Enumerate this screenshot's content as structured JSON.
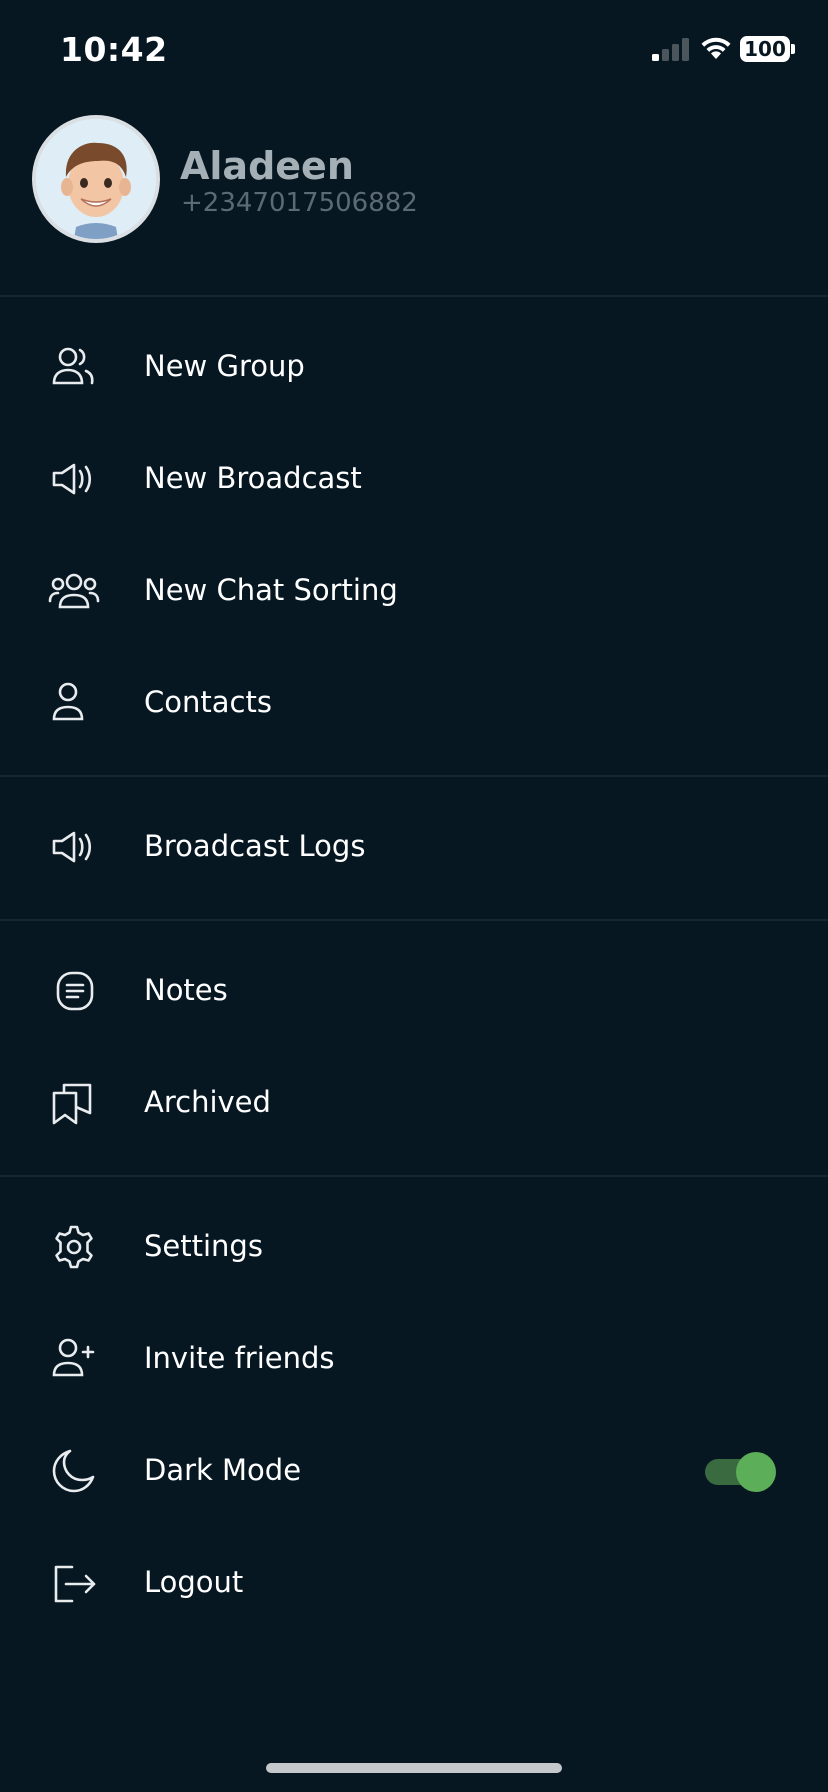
{
  "status_bar": {
    "time": "10:42",
    "battery": "100"
  },
  "profile": {
    "name": "Aladeen",
    "phone": "+2347017506882"
  },
  "menu": {
    "group1": [
      {
        "label": "New Group",
        "icon": "group-icon"
      },
      {
        "label": "New Broadcast",
        "icon": "megaphone-icon"
      },
      {
        "label": "New Chat Sorting",
        "icon": "users-sort-icon"
      },
      {
        "label": "Contacts",
        "icon": "person-icon"
      }
    ],
    "group2": [
      {
        "label": "Broadcast Logs",
        "icon": "megaphone-icon"
      }
    ],
    "group3": [
      {
        "label": "Notes",
        "icon": "notes-icon"
      },
      {
        "label": "Archived",
        "icon": "bookmarks-icon"
      }
    ],
    "group4": [
      {
        "label": "Settings",
        "icon": "gear-icon"
      },
      {
        "label": "Invite friends",
        "icon": "person-add-icon"
      },
      {
        "label": "Dark Mode",
        "icon": "moon-icon",
        "toggle_on": true
      },
      {
        "label": "Logout",
        "icon": "logout-icon"
      }
    ]
  },
  "colors": {
    "background": "#071722",
    "divider": "#16252f",
    "toggle_knob": "#5cae58",
    "toggle_track": "#3a6b40"
  }
}
